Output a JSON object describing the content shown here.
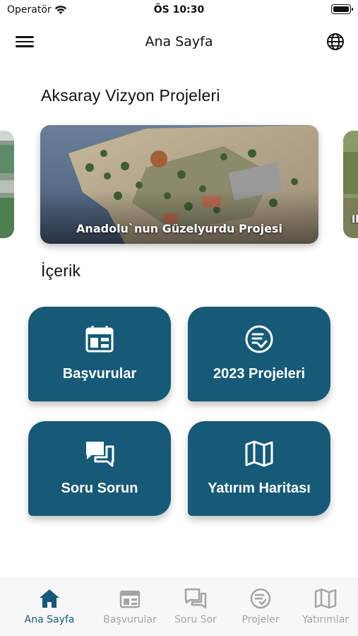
{
  "status_bar": {
    "carrier": "Operatör",
    "time": "ÖS 10:30"
  },
  "nav": {
    "title": "Ana Sayfa"
  },
  "vizyon": {
    "title": "Aksaray Vizyon Projeleri",
    "cards": [
      {
        "caption": "Anadolu`nun Güzelyurdu Projesi"
      },
      {
        "caption": "Ih"
      }
    ]
  },
  "icerik": {
    "title": "İçerik",
    "tiles": [
      {
        "label": "Başvurular",
        "icon": "calendar-icon"
      },
      {
        "label": "2023 Projeleri",
        "icon": "document-check-icon"
      },
      {
        "label": "Soru Sorun",
        "icon": "chat-bubbles-icon"
      },
      {
        "label": "Yatırım Haritası",
        "icon": "map-icon"
      }
    ]
  },
  "tab_bar": {
    "tabs": [
      {
        "label": "Ana Sayfa",
        "icon": "home-icon",
        "active": true
      },
      {
        "label": "Başvurular",
        "icon": "calendar-icon"
      },
      {
        "label": "Soru Sor",
        "icon": "chat-bubbles-icon"
      },
      {
        "label": "Projeler",
        "icon": "document-check-icon"
      },
      {
        "label": "Yatırımlar",
        "icon": "map-icon"
      }
    ]
  },
  "colors": {
    "primary": "#175a77",
    "tab_inactive": "#a4a4a4"
  }
}
